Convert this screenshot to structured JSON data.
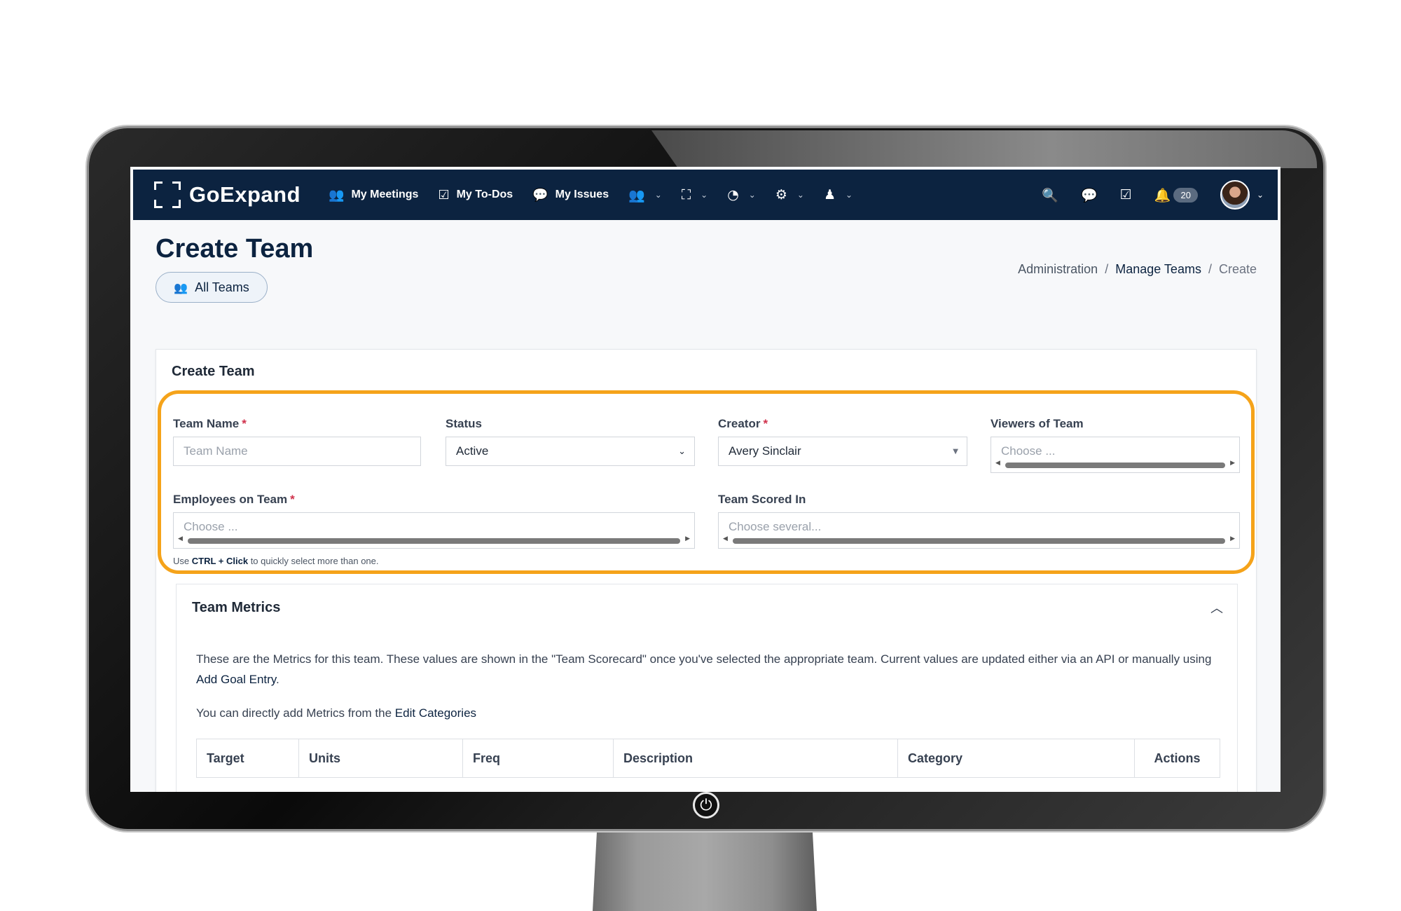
{
  "nav": {
    "logo": "GoExpand",
    "items": [
      {
        "label": "My Meetings",
        "icon": "meetings-icon",
        "glyph": "👥"
      },
      {
        "label": "My To-Dos",
        "icon": "checkbox-icon",
        "glyph": "☑"
      },
      {
        "label": "My Issues",
        "icon": "chat-bubbles-icon",
        "glyph": "💬"
      }
    ],
    "dropdowns": [
      {
        "icon": "users-icon",
        "glyph": "👥"
      },
      {
        "icon": "org-chart-icon",
        "glyph": "⛶"
      },
      {
        "icon": "dashboard-gauge-icon",
        "glyph": "◔"
      },
      {
        "icon": "settings-gear-icon",
        "glyph": "⚙"
      },
      {
        "icon": "user-tie-icon",
        "glyph": "♟"
      }
    ],
    "notification_count": "20"
  },
  "page": {
    "title": "Create Team",
    "all_teams_label": "All Teams",
    "breadcrumb": {
      "first": "Administration",
      "second": "Manage Teams",
      "current": "Create"
    }
  },
  "form": {
    "card_title": "Create Team",
    "team_name_label": "Team Name",
    "team_name_placeholder": "Team Name",
    "status_label": "Status",
    "status_value": "Active",
    "creator_label": "Creator",
    "creator_value": "Avery Sinclair",
    "viewers_label": "Viewers of Team",
    "viewers_placeholder": "Choose ...",
    "employees_label": "Employees on Team",
    "employees_placeholder": "Choose ...",
    "scored_label": "Team Scored In",
    "scored_placeholder": "Choose several...",
    "hint_prefix": "Use",
    "hint_keys": "CTRL + Click",
    "hint_suffix": "to quickly select more than one."
  },
  "metrics": {
    "title": "Team Metrics",
    "desc_text": "These are the Metrics for this team. These values are shown in the \"Team Scorecard\" once you've selected the appropriate team. Current values are updated either via an API or manually using",
    "desc_link": "Add Goal Entry",
    "note_text": "You can directly add Metrics from the",
    "note_link": "Edit Categories",
    "columns": [
      "Target",
      "Units",
      "Freq",
      "Description",
      "Category",
      "Actions"
    ]
  },
  "colors": {
    "navbar": "#0c2340",
    "highlight": "#f5a31a",
    "required": "#d0314b"
  }
}
